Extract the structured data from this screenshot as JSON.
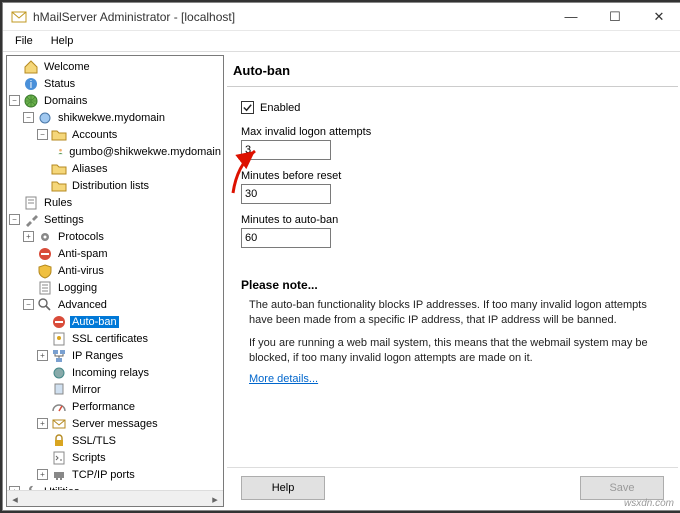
{
  "window": {
    "title": "hMailServer Administrator - [localhost]"
  },
  "menu": {
    "file": "File",
    "help": "Help"
  },
  "tree": {
    "welcome": "Welcome",
    "status": "Status",
    "domains": "Domains",
    "domain1": "shikwekwe.mydomain",
    "accounts": "Accounts",
    "account1": "gumbo@shikwekwe.mydomain",
    "aliases": "Aliases",
    "distlists": "Distribution lists",
    "rules": "Rules",
    "settings": "Settings",
    "protocols": "Protocols",
    "antispam": "Anti-spam",
    "antivirus": "Anti-virus",
    "logging": "Logging",
    "advanced": "Advanced",
    "autoban": "Auto-ban",
    "sslcerts": "SSL certificates",
    "ipranges": "IP Ranges",
    "increlays": "Incoming relays",
    "mirror": "Mirror",
    "performance": "Performance",
    "servermsgs": "Server messages",
    "ssltls": "SSL/TLS",
    "scripts": "Scripts",
    "tcpip": "TCP/IP ports",
    "utilities": "Utilities"
  },
  "page": {
    "title": "Auto-ban",
    "enabled_label": "Enabled",
    "enabled": true,
    "max_label": "Max invalid logon attempts",
    "max_value": "3",
    "reset_label": "Minutes before reset",
    "reset_value": "30",
    "ban_label": "Minutes to auto-ban",
    "ban_value": "60",
    "note_title": "Please note...",
    "note1": "The auto-ban functionality blocks IP addresses. If too many invalid logon attempts have been made from a specific IP address, that IP address will be banned.",
    "note2": "If you are running a web mail system, this means that the webmail system may be blocked, if too many invalid logon attempts are made on it.",
    "more": "More details...",
    "help": "Help",
    "save": "Save"
  },
  "watermark": "wsxdn.com"
}
